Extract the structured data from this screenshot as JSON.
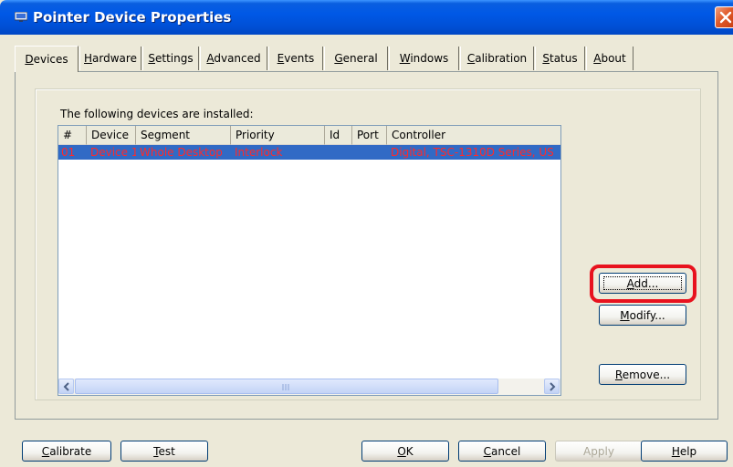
{
  "window": {
    "title": "Pointer Device Properties",
    "icon": "pointer-device-icon",
    "close_icon": "close-icon"
  },
  "tabs": [
    {
      "label": "Devices",
      "active": true
    },
    {
      "label": "Hardware"
    },
    {
      "label": "Settings"
    },
    {
      "label": "Advanced"
    },
    {
      "label": "Events"
    },
    {
      "label": "General"
    },
    {
      "label": "Windows"
    },
    {
      "label": "Calibration"
    },
    {
      "label": "Status"
    },
    {
      "label": "About"
    }
  ],
  "devices": {
    "list_label": "The following devices are installed:",
    "columns": [
      "#",
      "Device",
      "Segment",
      "Priority",
      "Id",
      "Port",
      "Controller"
    ],
    "rows": [
      {
        "num": "01",
        "device": "Device 1",
        "segment": "Whole Desktop",
        "priority": "Interlock",
        "id": "",
        "port": "",
        "controller": "Digital, TSC-1310D Series, US"
      }
    ],
    "selected_row_color": "#316AC5",
    "row_text_color": "#FF2A2A"
  },
  "side_buttons": {
    "add": "Add...",
    "modify": "Modify...",
    "remove": "Remove..."
  },
  "bottom_buttons": {
    "calibrate": "Calibrate",
    "test": "Test",
    "ok": "OK",
    "cancel": "Cancel",
    "apply": "Apply",
    "help": "Help"
  },
  "highlight_color": "#E8121E"
}
